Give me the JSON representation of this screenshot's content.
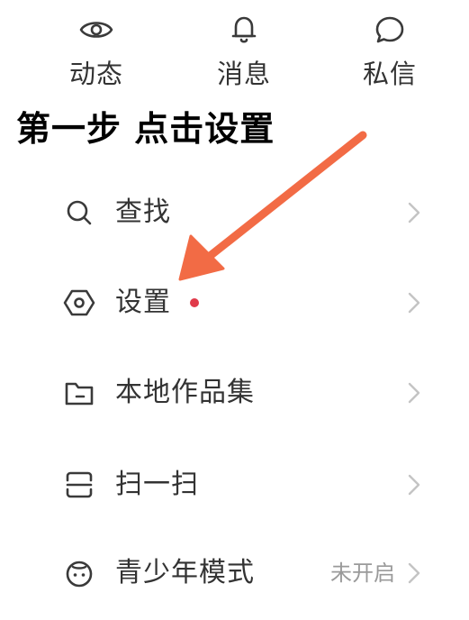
{
  "colors": {
    "text": "#333333",
    "icon": "#3a3a3a",
    "secondary": "#9a9a9a",
    "badge": "#e03a4a",
    "annotation_arrow": "#f26b45"
  },
  "top_nav": {
    "items": [
      {
        "label": "动态",
        "icon": "eye-icon"
      },
      {
        "label": "消息",
        "icon": "bell-icon"
      },
      {
        "label": "私信",
        "icon": "chat-bubble-icon"
      }
    ]
  },
  "annotation": {
    "headline": "第一步 点击设置"
  },
  "menu": {
    "items": [
      {
        "label": "查找",
        "icon": "search-icon",
        "value": "",
        "badge": false
      },
      {
        "label": "设置",
        "icon": "settings-hexagon-icon",
        "value": "",
        "badge": true
      },
      {
        "label": "本地作品集",
        "icon": "folder-icon",
        "value": "",
        "badge": false
      },
      {
        "label": "扫一扫",
        "icon": "scan-icon",
        "value": "",
        "badge": false
      },
      {
        "label": "青少年模式",
        "icon": "teen-mode-icon",
        "value": "未开启",
        "badge": false
      }
    ]
  }
}
